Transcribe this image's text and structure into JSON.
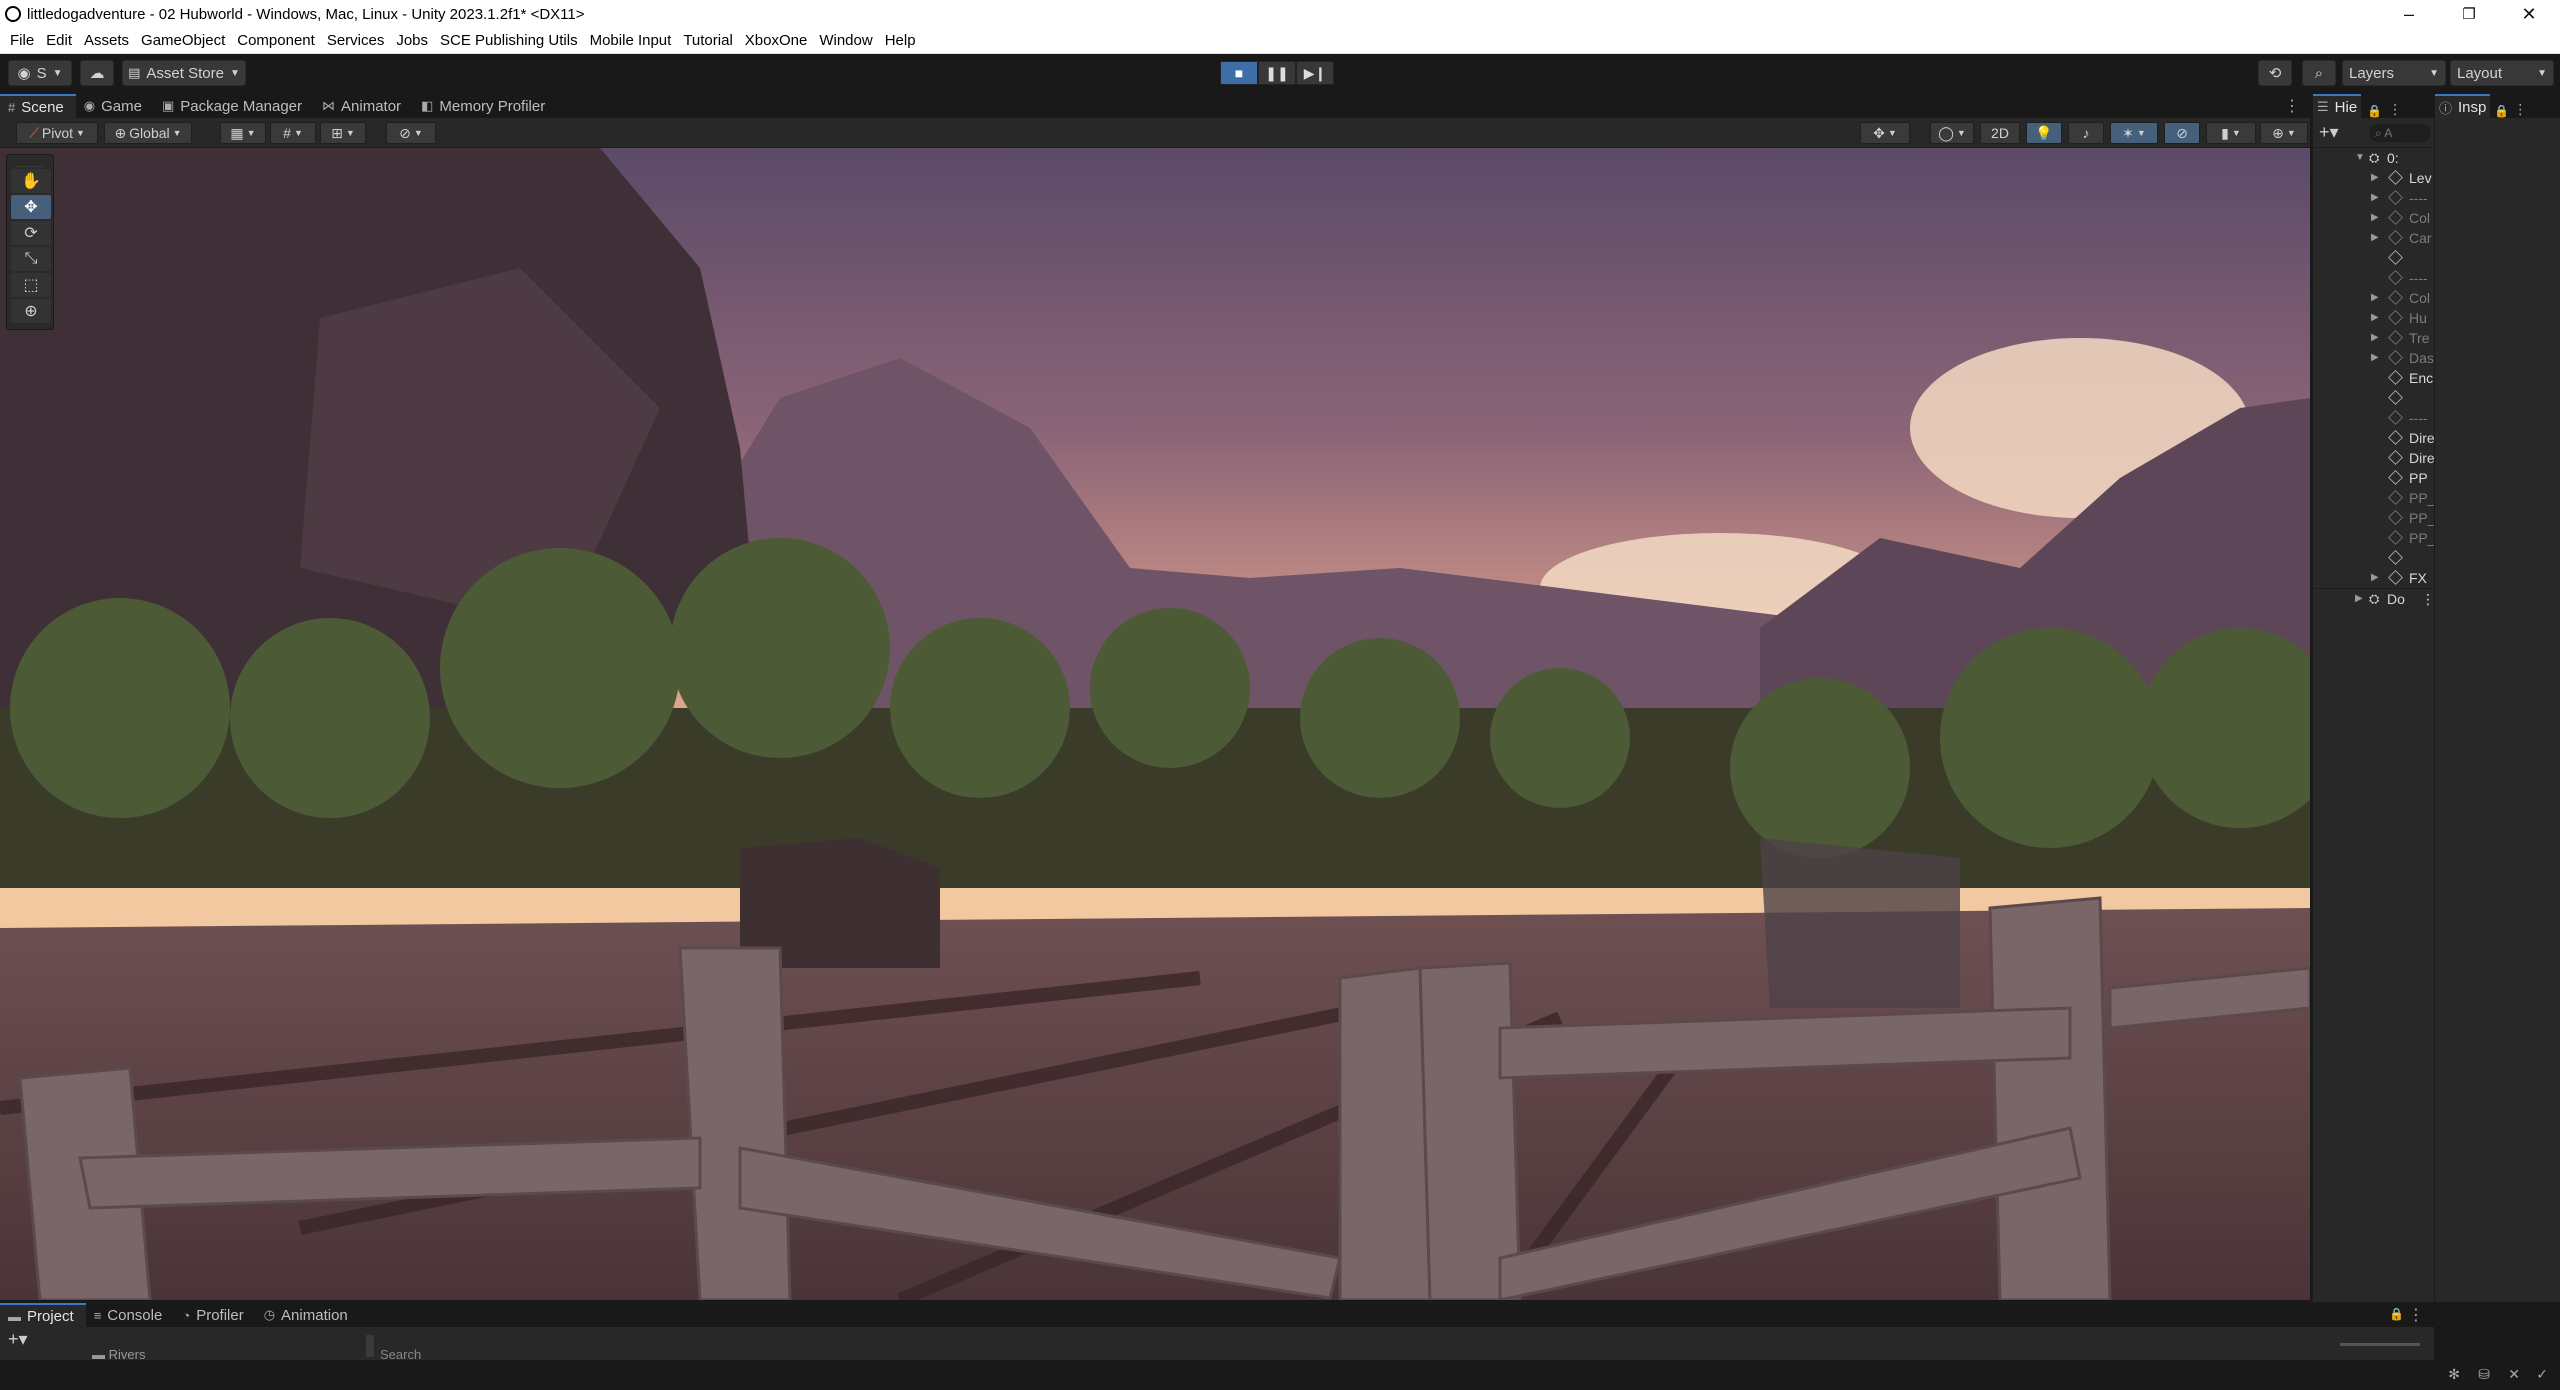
{
  "window": {
    "title": "littledogadventure - 02 Hubworld - Windows, Mac, Linux - Unity 2023.1.2f1* <DX11>",
    "controls": {
      "minimize": "–",
      "maximize": "❐",
      "close": "✕"
    }
  },
  "menu": [
    "File",
    "Edit",
    "Assets",
    "GameObject",
    "Component",
    "Services",
    "Jobs",
    "SCE Publishing Utils",
    "Mobile Input",
    "Tutorial",
    "XboxOne",
    "Window",
    "Help"
  ],
  "toolbar": {
    "account_label": "S",
    "asset_store_label": "Asset Store",
    "layers_label": "Layers",
    "layout_label": "Layout",
    "play_icons": {
      "play": "■",
      "pause": "❚❚",
      "step": "▶❙"
    }
  },
  "scene_tabs": [
    {
      "label": "Scene",
      "icon": "#"
    },
    {
      "label": "Game",
      "icon": "◉"
    },
    {
      "label": "Package Manager",
      "icon": "▣"
    },
    {
      "label": "Animator",
      "icon": "⋈"
    },
    {
      "label": "Memory Profiler",
      "icon": "◧"
    }
  ],
  "scene_toolbar": {
    "pivot_label": "Pivot",
    "global_label": "Global",
    "mode_2d_label": "2D"
  },
  "tools": [
    {
      "name": "hand-tool",
      "glyph": "✋",
      "active": false
    },
    {
      "name": "move-tool",
      "glyph": "✥",
      "active": true
    },
    {
      "name": "rotate-tool",
      "glyph": "⟳",
      "active": false
    },
    {
      "name": "scale-tool",
      "glyph": "⤡",
      "active": false
    },
    {
      "name": "rect-tool",
      "glyph": "⬚",
      "active": false
    },
    {
      "name": "transform-tool",
      "glyph": "⊕",
      "active": false
    }
  ],
  "hierarchy": {
    "tab_label": "Hie",
    "search_placeholder": "A",
    "root_label": "0:",
    "rows": [
      {
        "label": "Lev",
        "arrow": true,
        "dim": false
      },
      {
        "label": "----",
        "arrow": true,
        "dim": true
      },
      {
        "label": "Col",
        "arrow": true,
        "dim": true
      },
      {
        "label": "Car",
        "arrow": true,
        "dim": true
      },
      {
        "label": "",
        "arrow": false,
        "dim": false
      },
      {
        "label": "----",
        "arrow": false,
        "dim": true
      },
      {
        "label": "Col",
        "arrow": true,
        "dim": true
      },
      {
        "label": "Hu",
        "arrow": true,
        "dim": true
      },
      {
        "label": "Tre",
        "arrow": true,
        "dim": true
      },
      {
        "label": "Das",
        "arrow": true,
        "dim": true
      },
      {
        "label": "Enc",
        "arrow": false,
        "dim": false
      },
      {
        "label": "",
        "arrow": false,
        "dim": false
      },
      {
        "label": "----",
        "arrow": false,
        "dim": true
      },
      {
        "label": "Dire",
        "arrow": false,
        "dim": false
      },
      {
        "label": "Dire",
        "arrow": false,
        "dim": false
      },
      {
        "label": "PP",
        "arrow": false,
        "dim": false
      },
      {
        "label": "PP_",
        "arrow": false,
        "dim": true
      },
      {
        "label": "PP_",
        "arrow": false,
        "dim": true
      },
      {
        "label": "PP_",
        "arrow": false,
        "dim": true
      },
      {
        "label": "",
        "arrow": false,
        "dim": false
      },
      {
        "label": "FX",
        "arrow": true,
        "dim": false
      }
    ],
    "dontdestroy_label": "Do"
  },
  "inspector": {
    "tab_label": "Insp"
  },
  "bottom_tabs": [
    {
      "label": "Project",
      "icon": "▬"
    },
    {
      "label": "Console",
      "icon": "≡"
    },
    {
      "label": "Profiler",
      "icon": "◔"
    },
    {
      "label": "Animation",
      "icon": "◷"
    }
  ],
  "bottom": {
    "folder_label": "Rivers",
    "search_label": "Search"
  }
}
